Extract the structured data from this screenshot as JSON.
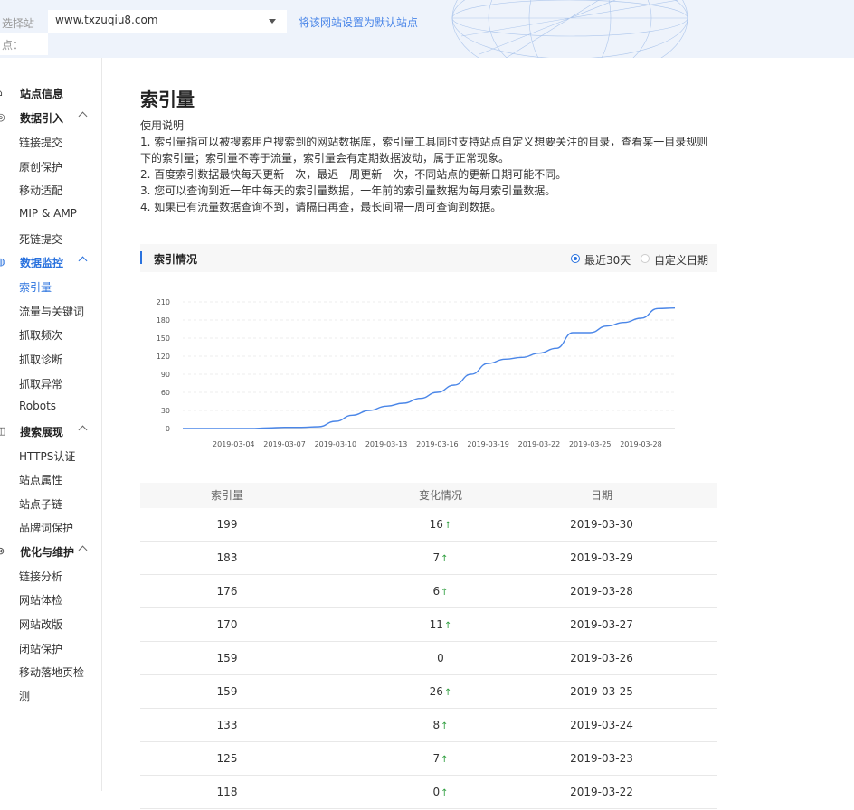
{
  "header": {
    "site_label_line1": "选择站",
    "site_label_line2": "点：",
    "site_value": "www.txzuqiu8.com",
    "set_default_link": "将该网站设置为默认站点"
  },
  "sidebar": {
    "groups": [
      {
        "label": "站点信息",
        "icon": "home-icon",
        "items": []
      },
      {
        "label": "数据引入",
        "icon": "import-icon",
        "items": [
          "链接提交",
          "原创保护",
          "移动适配",
          "MIP & AMP",
          "死链提交"
        ]
      },
      {
        "label": "数据监控",
        "icon": "monitor-icon",
        "active": true,
        "items": [
          "索引量",
          "流量与关键词",
          "抓取频次",
          "抓取诊断",
          "抓取异常",
          "Robots"
        ]
      },
      {
        "label": "搜索展现",
        "icon": "display-icon",
        "items": [
          "HTTPS认证",
          "站点属性",
          "站点子链",
          "品牌词保护"
        ]
      },
      {
        "label": "优化与维护",
        "icon": "wrench-icon",
        "items": [
          "链接分析",
          "网站体检",
          "网站改版",
          "闭站保护",
          "移动落地页检",
          "测"
        ]
      }
    ],
    "active_item": "索引量"
  },
  "main": {
    "title": "索引量",
    "usage_title": "使用说明",
    "usage_lines": [
      "1. 索引量指可以被搜索用户搜索到的网站数据库，索引量工具同时支持站点自定义想要关注的目录，查看某一目录规则",
      "下的索引量；索引量不等于流量，索引量会有定期数据波动，属于正常现象。",
      "2. 百度索引数据最快每天更新一次，最迟一周更新一次，不同站点的更新日期可能不同。",
      "3. 您可以查询到近一年中每天的索引量数据，一年前的索引量数据为每月索引量数据。",
      "4. 如果已有流量数据查询不到，请隔日再查，最长间隔一周可查询到数据。"
    ],
    "panel_title": "索引情况",
    "radio_recent": "最近30天",
    "radio_custom": "自定义日期"
  },
  "chart_data": {
    "type": "line",
    "x": [
      "2019-03-01",
      "2019-03-02",
      "2019-03-03",
      "2019-03-04",
      "2019-03-05",
      "2019-03-06",
      "2019-03-07",
      "2019-03-08",
      "2019-03-09",
      "2019-03-10",
      "2019-03-11",
      "2019-03-12",
      "2019-03-13",
      "2019-03-14",
      "2019-03-15",
      "2019-03-16",
      "2019-03-17",
      "2019-03-18",
      "2019-03-19",
      "2019-03-20",
      "2019-03-21",
      "2019-03-22",
      "2019-03-23",
      "2019-03-24",
      "2019-03-25",
      "2019-03-26",
      "2019-03-27",
      "2019-03-28",
      "2019-03-29",
      "2019-03-30"
    ],
    "x_tick_labels": [
      "2019-03-04",
      "2019-03-07",
      "2019-03-10",
      "2019-03-13",
      "2019-03-16",
      "2019-03-19",
      "2019-03-22",
      "2019-03-25",
      "2019-03-28"
    ],
    "series": [
      {
        "values": [
          0,
          0,
          0,
          0,
          0,
          1,
          2,
          2,
          3,
          12,
          22,
          30,
          37,
          42,
          50,
          60,
          72,
          90,
          108,
          115,
          118,
          125,
          133,
          159,
          159,
          170,
          176,
          183,
          199,
          200
        ]
      }
    ],
    "y_ticks": [
      0,
      30,
      60,
      90,
      120,
      150,
      180,
      210
    ],
    "ylim": [
      0,
      210
    ],
    "grid": true,
    "line_color": "#4a86e8"
  },
  "table": {
    "headers": [
      "索引量",
      "变化情况",
      "日期"
    ],
    "rows": [
      {
        "count": "199",
        "change": "16",
        "up": true,
        "date": "2019-03-30"
      },
      {
        "count": "183",
        "change": "7",
        "up": true,
        "date": "2019-03-29"
      },
      {
        "count": "176",
        "change": "6",
        "up": true,
        "date": "2019-03-28"
      },
      {
        "count": "170",
        "change": "11",
        "up": true,
        "date": "2019-03-27"
      },
      {
        "count": "159",
        "change": "0",
        "up": false,
        "date": "2019-03-26"
      },
      {
        "count": "159",
        "change": "26",
        "up": true,
        "date": "2019-03-25"
      },
      {
        "count": "133",
        "change": "8",
        "up": true,
        "date": "2019-03-24"
      },
      {
        "count": "125",
        "change": "7",
        "up": true,
        "date": "2019-03-23"
      },
      {
        "count": "118",
        "change": "0",
        "up": true,
        "date": "2019-03-22"
      }
    ]
  }
}
